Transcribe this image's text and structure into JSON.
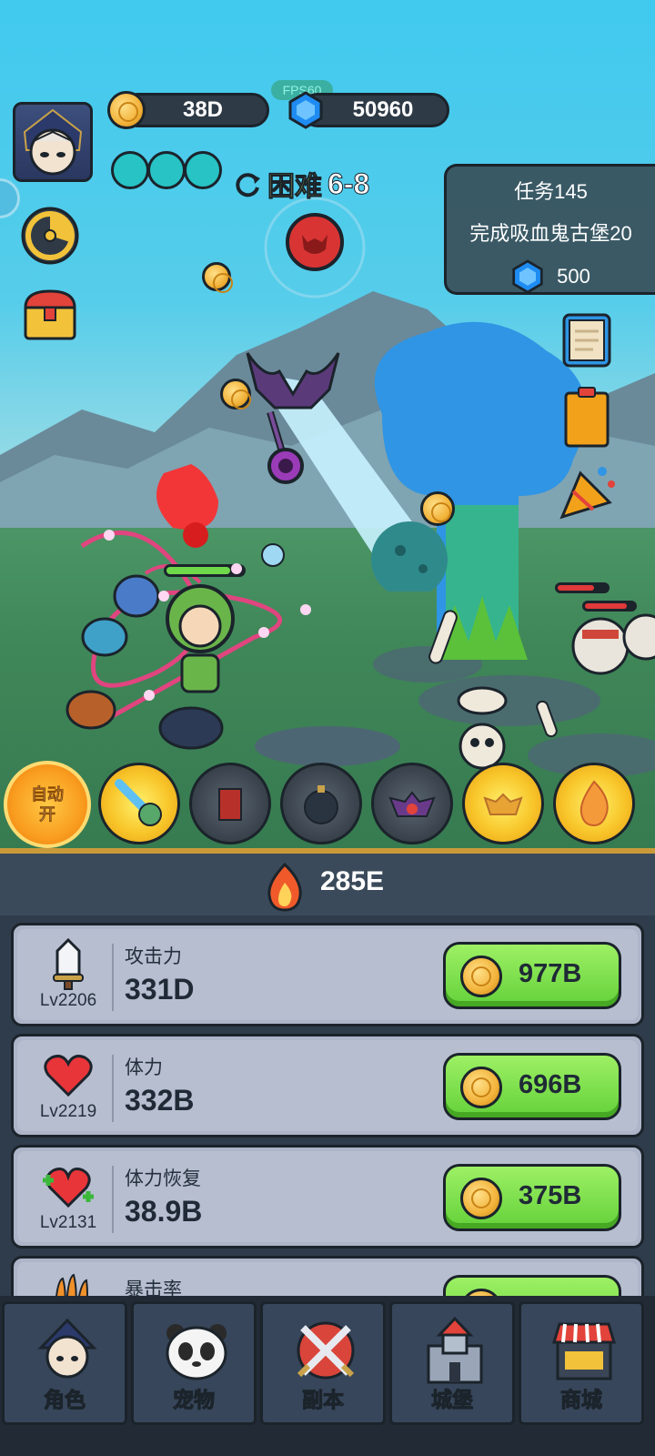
{
  "currency": {
    "gold": "38D",
    "gems": "50960",
    "fps": "FPS60"
  },
  "stage": {
    "difficulty": "困难",
    "number": "6-8"
  },
  "quest": {
    "title": "任务145",
    "description": "完成吸血鬼古堡20",
    "reward": "500"
  },
  "auto_button": {
    "line1": "自动",
    "line2": "开"
  },
  "power": "285E",
  "upgrades": [
    {
      "name": "攻击力",
      "value": "331D",
      "level": "Lv2206",
      "price": "977B",
      "icon": "sword-icon"
    },
    {
      "name": "体力",
      "value": "332B",
      "level": "Lv2219",
      "price": "696B",
      "icon": "heart-icon"
    },
    {
      "name": "体力恢复",
      "value": "38.9B",
      "level": "Lv2131",
      "price": "375B",
      "icon": "heart-regen-icon"
    },
    {
      "name": "暴击率",
      "value": "",
      "level": "",
      "price": "",
      "icon": "claw-icon"
    }
  ],
  "nav": [
    {
      "label": "角色",
      "icon": "hero-icon"
    },
    {
      "label": "宠物",
      "icon": "panda-icon"
    },
    {
      "label": "副本",
      "icon": "crossed-swords-icon"
    },
    {
      "label": "城堡",
      "icon": "castle-icon"
    },
    {
      "label": "商城",
      "icon": "shop-icon"
    }
  ],
  "colors": {
    "sky": "#41c9ee",
    "grass": "#3f8658",
    "buy_green": "#64d13a",
    "panel": "#2f3c4b"
  }
}
